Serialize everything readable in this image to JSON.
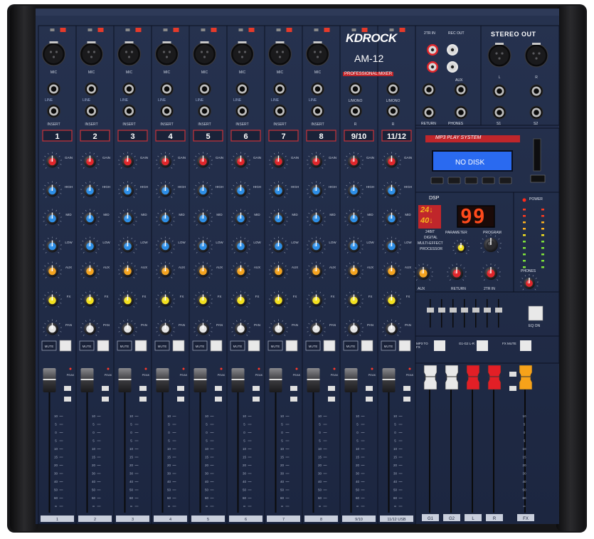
{
  "brand": {
    "logo": "KDROCK",
    "model": "AM-12",
    "subtitle": "PROFESSIONAL MIXER"
  },
  "channels": [
    {
      "label": "1",
      "bottom": "1"
    },
    {
      "label": "2",
      "bottom": "2"
    },
    {
      "label": "3",
      "bottom": "3"
    },
    {
      "label": "4",
      "bottom": "4"
    },
    {
      "label": "5",
      "bottom": "5"
    },
    {
      "label": "6",
      "bottom": "6"
    },
    {
      "label": "7",
      "bottom": "7"
    },
    {
      "label": "8",
      "bottom": "8"
    },
    {
      "label": "9/10",
      "bottom": "9/10"
    },
    {
      "label": "11/12",
      "bottom": "11/12 USB"
    }
  ],
  "input_labels": {
    "mic": "MIC",
    "line": "LINE",
    "insert": "INSERT",
    "l_mono": "L/MONO",
    "r": "R"
  },
  "knob_labels": {
    "gain": "GAIN",
    "high": "HIGH",
    "mid": "MID",
    "low": "LOW",
    "aux": "AUX",
    "fx": "FX",
    "pan": "PAN"
  },
  "button_labels": {
    "mute": "MUTE",
    "peak": "PEAK"
  },
  "fader_scale": [
    "10",
    "5",
    "0",
    "5",
    "10",
    "15",
    "20",
    "30",
    "40",
    "50",
    "60",
    "∞"
  ],
  "io_panel": {
    "str_in": "2TR IN",
    "rec_out": "REC OUT",
    "aux": "AUX",
    "return": "RETURN",
    "phones": "PHONES",
    "stereo_out": "STEREO OUT",
    "l": "L",
    "r": "R",
    "s1": "S1",
    "s2": "S2"
  },
  "mp3": {
    "title": "MP3 PLAY SYSTEM",
    "display": "NO DISK"
  },
  "dsp": {
    "title": "DSP",
    "badge_top": "24↓",
    "badge_bottom": "40↓",
    "preset": "99",
    "line1": "24BIT",
    "line2": "DIGITAL",
    "line3": "MULTI-EFFECT",
    "line4": "PROCESSOR",
    "parameter": "PARAMETER",
    "program": "PROGRAM"
  },
  "master_knobs": {
    "aux": "AUX",
    "return": "RETURN",
    "str": "2TR IN",
    "phones": "PHONES",
    "power": "POWER"
  },
  "eq": {
    "label": "EQ ON"
  },
  "group_buttons": {
    "mp3_to_fx": "MP3 TO FX",
    "g1g2_lr": "G1-G2 L-R",
    "fx_mute": "FX MUTE"
  },
  "master_faders": [
    {
      "label": "G1",
      "color": "#e8e8e8"
    },
    {
      "label": "G2",
      "color": "#e8e8e8"
    },
    {
      "label": "L",
      "color": "#e21f26"
    },
    {
      "label": "R",
      "color": "#e21f26"
    },
    {
      "label": "FX",
      "color": "#f6a21a"
    }
  ],
  "colors": {
    "panel": "#1f2a44",
    "frame": "#1a1a1c",
    "red": "#e0262b",
    "blue": "#2d8ee6",
    "orange": "#f4a31f",
    "yellow": "#f3e11f",
    "white": "#e6e6e6",
    "lcd": "#2a6af0",
    "led": "#ff3d1a"
  }
}
